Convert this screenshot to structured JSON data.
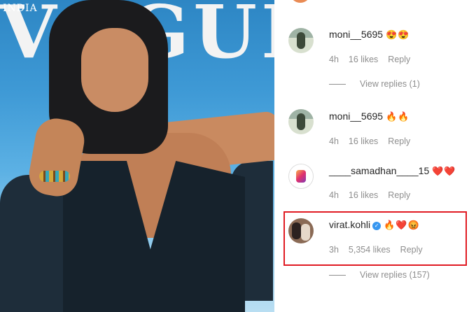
{
  "photo": {
    "masthead": "VOGUE",
    "masthead_small": "INDIA"
  },
  "colors": {
    "text": "#262626",
    "meta": "#8e8e8e",
    "verified": "#3897f0",
    "highlight": "#e01b23"
  },
  "comments": [
    {
      "username": "moni__5695",
      "emoji": "😍😍",
      "time": "4h",
      "likes": "16 likes",
      "reply": "Reply",
      "view_replies": "View replies (1)",
      "avatar_icon": "user-avatar-photo"
    },
    {
      "username": "moni__5695",
      "emoji": "🔥🔥",
      "time": "4h",
      "likes": "16 likes",
      "reply": "Reply",
      "avatar_icon": "user-avatar-photo"
    },
    {
      "username": "____samadhan____15",
      "emoji": "❤️❤️",
      "time": "4h",
      "likes": "16 likes",
      "reply": "Reply",
      "avatar_icon": "instagram-icon"
    },
    {
      "username": "virat.kohli",
      "verified": "✓",
      "emoji": "🔥❤️😡",
      "time": "3h",
      "likes": "5,354 likes",
      "reply": "Reply",
      "view_replies": "View replies (157)",
      "avatar_icon": "user-avatar-photo"
    }
  ]
}
